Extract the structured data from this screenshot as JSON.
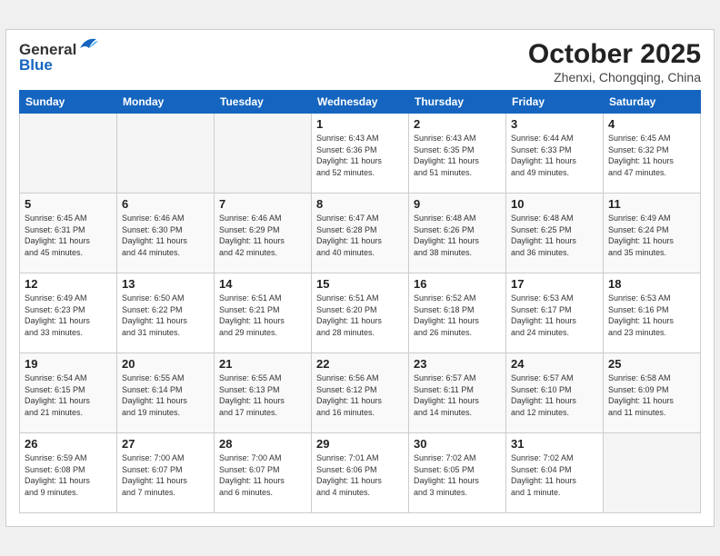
{
  "header": {
    "logo_line1": "General",
    "logo_line2": "Blue",
    "month": "October 2025",
    "location": "Zhenxi, Chongqing, China"
  },
  "weekdays": [
    "Sunday",
    "Monday",
    "Tuesday",
    "Wednesday",
    "Thursday",
    "Friday",
    "Saturday"
  ],
  "weeks": [
    [
      {
        "day": "",
        "info": ""
      },
      {
        "day": "",
        "info": ""
      },
      {
        "day": "",
        "info": ""
      },
      {
        "day": "1",
        "info": "Sunrise: 6:43 AM\nSunset: 6:36 PM\nDaylight: 11 hours\nand 52 minutes."
      },
      {
        "day": "2",
        "info": "Sunrise: 6:43 AM\nSunset: 6:35 PM\nDaylight: 11 hours\nand 51 minutes."
      },
      {
        "day": "3",
        "info": "Sunrise: 6:44 AM\nSunset: 6:33 PM\nDaylight: 11 hours\nand 49 minutes."
      },
      {
        "day": "4",
        "info": "Sunrise: 6:45 AM\nSunset: 6:32 PM\nDaylight: 11 hours\nand 47 minutes."
      }
    ],
    [
      {
        "day": "5",
        "info": "Sunrise: 6:45 AM\nSunset: 6:31 PM\nDaylight: 11 hours\nand 45 minutes."
      },
      {
        "day": "6",
        "info": "Sunrise: 6:46 AM\nSunset: 6:30 PM\nDaylight: 11 hours\nand 44 minutes."
      },
      {
        "day": "7",
        "info": "Sunrise: 6:46 AM\nSunset: 6:29 PM\nDaylight: 11 hours\nand 42 minutes."
      },
      {
        "day": "8",
        "info": "Sunrise: 6:47 AM\nSunset: 6:28 PM\nDaylight: 11 hours\nand 40 minutes."
      },
      {
        "day": "9",
        "info": "Sunrise: 6:48 AM\nSunset: 6:26 PM\nDaylight: 11 hours\nand 38 minutes."
      },
      {
        "day": "10",
        "info": "Sunrise: 6:48 AM\nSunset: 6:25 PM\nDaylight: 11 hours\nand 36 minutes."
      },
      {
        "day": "11",
        "info": "Sunrise: 6:49 AM\nSunset: 6:24 PM\nDaylight: 11 hours\nand 35 minutes."
      }
    ],
    [
      {
        "day": "12",
        "info": "Sunrise: 6:49 AM\nSunset: 6:23 PM\nDaylight: 11 hours\nand 33 minutes."
      },
      {
        "day": "13",
        "info": "Sunrise: 6:50 AM\nSunset: 6:22 PM\nDaylight: 11 hours\nand 31 minutes."
      },
      {
        "day": "14",
        "info": "Sunrise: 6:51 AM\nSunset: 6:21 PM\nDaylight: 11 hours\nand 29 minutes."
      },
      {
        "day": "15",
        "info": "Sunrise: 6:51 AM\nSunset: 6:20 PM\nDaylight: 11 hours\nand 28 minutes."
      },
      {
        "day": "16",
        "info": "Sunrise: 6:52 AM\nSunset: 6:18 PM\nDaylight: 11 hours\nand 26 minutes."
      },
      {
        "day": "17",
        "info": "Sunrise: 6:53 AM\nSunset: 6:17 PM\nDaylight: 11 hours\nand 24 minutes."
      },
      {
        "day": "18",
        "info": "Sunrise: 6:53 AM\nSunset: 6:16 PM\nDaylight: 11 hours\nand 23 minutes."
      }
    ],
    [
      {
        "day": "19",
        "info": "Sunrise: 6:54 AM\nSunset: 6:15 PM\nDaylight: 11 hours\nand 21 minutes."
      },
      {
        "day": "20",
        "info": "Sunrise: 6:55 AM\nSunset: 6:14 PM\nDaylight: 11 hours\nand 19 minutes."
      },
      {
        "day": "21",
        "info": "Sunrise: 6:55 AM\nSunset: 6:13 PM\nDaylight: 11 hours\nand 17 minutes."
      },
      {
        "day": "22",
        "info": "Sunrise: 6:56 AM\nSunset: 6:12 PM\nDaylight: 11 hours\nand 16 minutes."
      },
      {
        "day": "23",
        "info": "Sunrise: 6:57 AM\nSunset: 6:11 PM\nDaylight: 11 hours\nand 14 minutes."
      },
      {
        "day": "24",
        "info": "Sunrise: 6:57 AM\nSunset: 6:10 PM\nDaylight: 11 hours\nand 12 minutes."
      },
      {
        "day": "25",
        "info": "Sunrise: 6:58 AM\nSunset: 6:09 PM\nDaylight: 11 hours\nand 11 minutes."
      }
    ],
    [
      {
        "day": "26",
        "info": "Sunrise: 6:59 AM\nSunset: 6:08 PM\nDaylight: 11 hours\nand 9 minutes."
      },
      {
        "day": "27",
        "info": "Sunrise: 7:00 AM\nSunset: 6:07 PM\nDaylight: 11 hours\nand 7 minutes."
      },
      {
        "day": "28",
        "info": "Sunrise: 7:00 AM\nSunset: 6:07 PM\nDaylight: 11 hours\nand 6 minutes."
      },
      {
        "day": "29",
        "info": "Sunrise: 7:01 AM\nSunset: 6:06 PM\nDaylight: 11 hours\nand 4 minutes."
      },
      {
        "day": "30",
        "info": "Sunrise: 7:02 AM\nSunset: 6:05 PM\nDaylight: 11 hours\nand 3 minutes."
      },
      {
        "day": "31",
        "info": "Sunrise: 7:02 AM\nSunset: 6:04 PM\nDaylight: 11 hours\nand 1 minute."
      },
      {
        "day": "",
        "info": ""
      }
    ]
  ]
}
